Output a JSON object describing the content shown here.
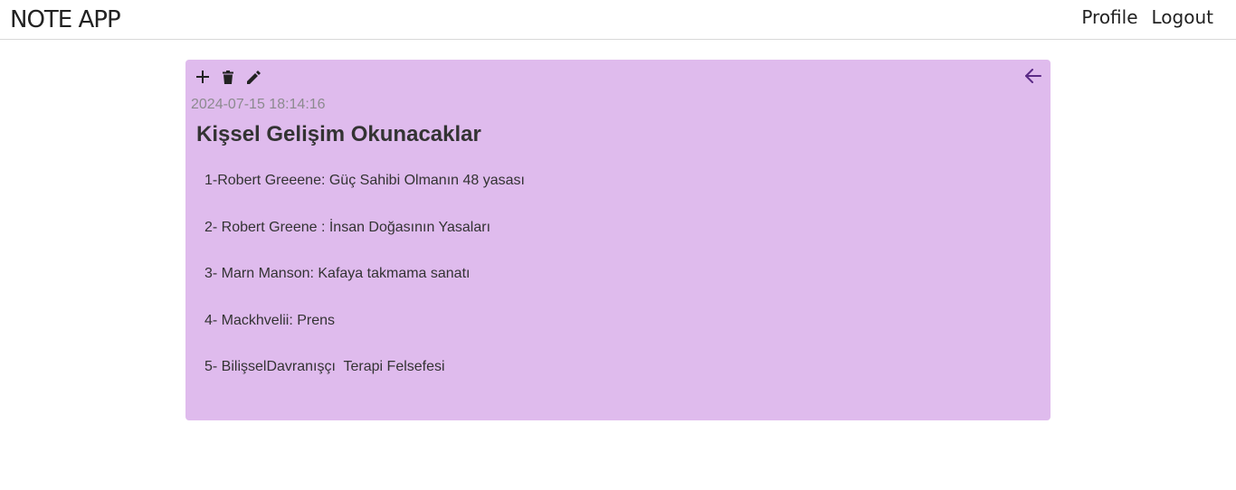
{
  "app": {
    "title": "NOTE APP"
  },
  "nav": {
    "profile_label": "Profile",
    "logout_label": "Logout"
  },
  "note": {
    "timestamp": "2024-07-15 18:14:16",
    "title": "Kişsel Gelişim Okunacaklar",
    "lines": [
      "1-Robert Greeene: Güç Sahibi Olmanın 48 yasası",
      "2- Robert Greene : İnsan Doğasının Yasaları",
      "3- Marn Manson: Kafaya takmama sanatı",
      "4- Mackhvelii: Prens",
      "5- BilişselDavranışçı  Terapi Felsefesi"
    ],
    "background_color": "#dfbbed",
    "toolbar_icons": [
      "add-icon",
      "delete-icon",
      "edit-icon"
    ],
    "back_icon": "arrow-left-icon",
    "back_icon_color": "#5b2a86"
  }
}
